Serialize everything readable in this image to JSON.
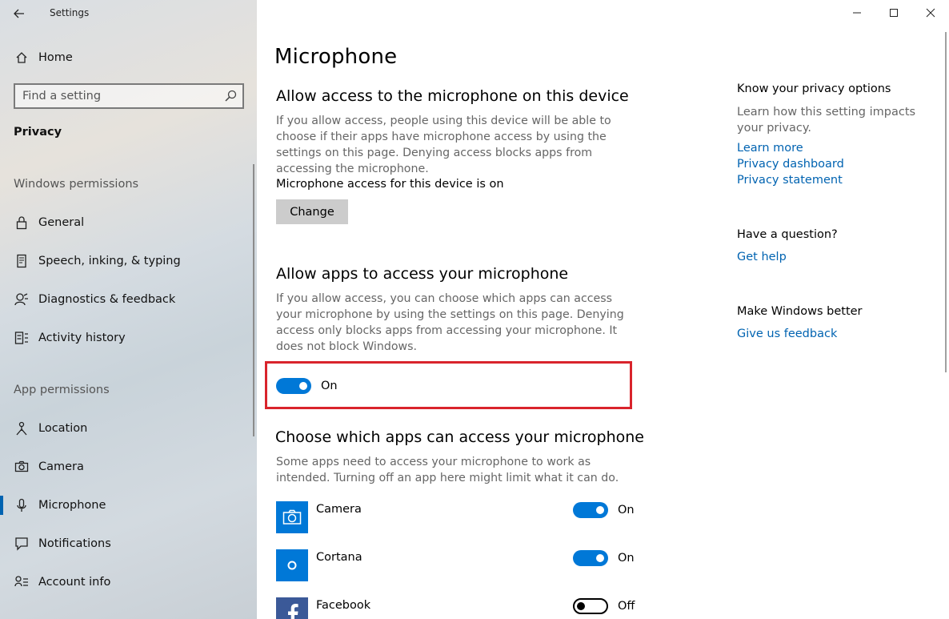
{
  "window": {
    "title": "Settings",
    "controls": [
      "minimize-icon",
      "maximize-icon",
      "close-icon"
    ]
  },
  "sidebar": {
    "home_label": "Home",
    "search_placeholder": "Find a setting",
    "section_title": "Privacy",
    "windows_permissions_label": "Windows permissions",
    "windows_items": [
      {
        "label": "General",
        "icon": "lock-icon"
      },
      {
        "label": "Speech, inking, & typing",
        "icon": "speech-icon"
      },
      {
        "label": "Diagnostics & feedback",
        "icon": "diagnostics-icon"
      },
      {
        "label": "Activity history",
        "icon": "activity-history-icon"
      }
    ],
    "app_permissions_label": "App permissions",
    "app_items": [
      {
        "label": "Location",
        "icon": "location-icon"
      },
      {
        "label": "Camera",
        "icon": "camera-icon"
      },
      {
        "label": "Microphone",
        "icon": "microphone-icon",
        "active": true
      },
      {
        "label": "Notifications",
        "icon": "notifications-icon"
      },
      {
        "label": "Account info",
        "icon": "account-info-icon"
      }
    ]
  },
  "main": {
    "page_title": "Microphone",
    "device_section": {
      "heading": "Allow access to the microphone on this device",
      "description": "If you allow access, people using this device will be able to choose if their apps have microphone access by using the settings on this page. Denying access blocks apps from accessing the microphone.",
      "status": "Microphone access for this device is on",
      "change_label": "Change"
    },
    "apps_section": {
      "heading": "Allow apps to access your microphone",
      "description": "If you allow access, you can choose which apps can access your microphone by using the settings on this page. Denying access only blocks apps from accessing your microphone. It does not block Windows.",
      "toggle_state": "On",
      "highlight_color": "#d9242c"
    },
    "choose_section": {
      "heading": "Choose which apps can access your microphone",
      "description": "Some apps need to access your microphone to work as intended. Turning off an app here might limit what it can do.",
      "apps": [
        {
          "name": "Camera",
          "state": "On",
          "icon": "camera-app-icon"
        },
        {
          "name": "Cortana",
          "state": "On",
          "icon": "cortana-app-icon"
        },
        {
          "name": "Facebook",
          "state": "Off",
          "icon": "facebook-app-icon"
        }
      ]
    }
  },
  "right_panel": {
    "privacy_options_heading": "Know your privacy options",
    "privacy_options_text": "Learn how this setting impacts your privacy.",
    "links": [
      "Learn more",
      "Privacy dashboard",
      "Privacy statement"
    ],
    "question_heading": "Have a question?",
    "help_link": "Get help",
    "better_heading": "Make Windows better",
    "feedback_link": "Give us feedback"
  },
  "colors": {
    "accent": "#0078d7",
    "link": "#0063b1",
    "highlight": "#d9242c"
  }
}
